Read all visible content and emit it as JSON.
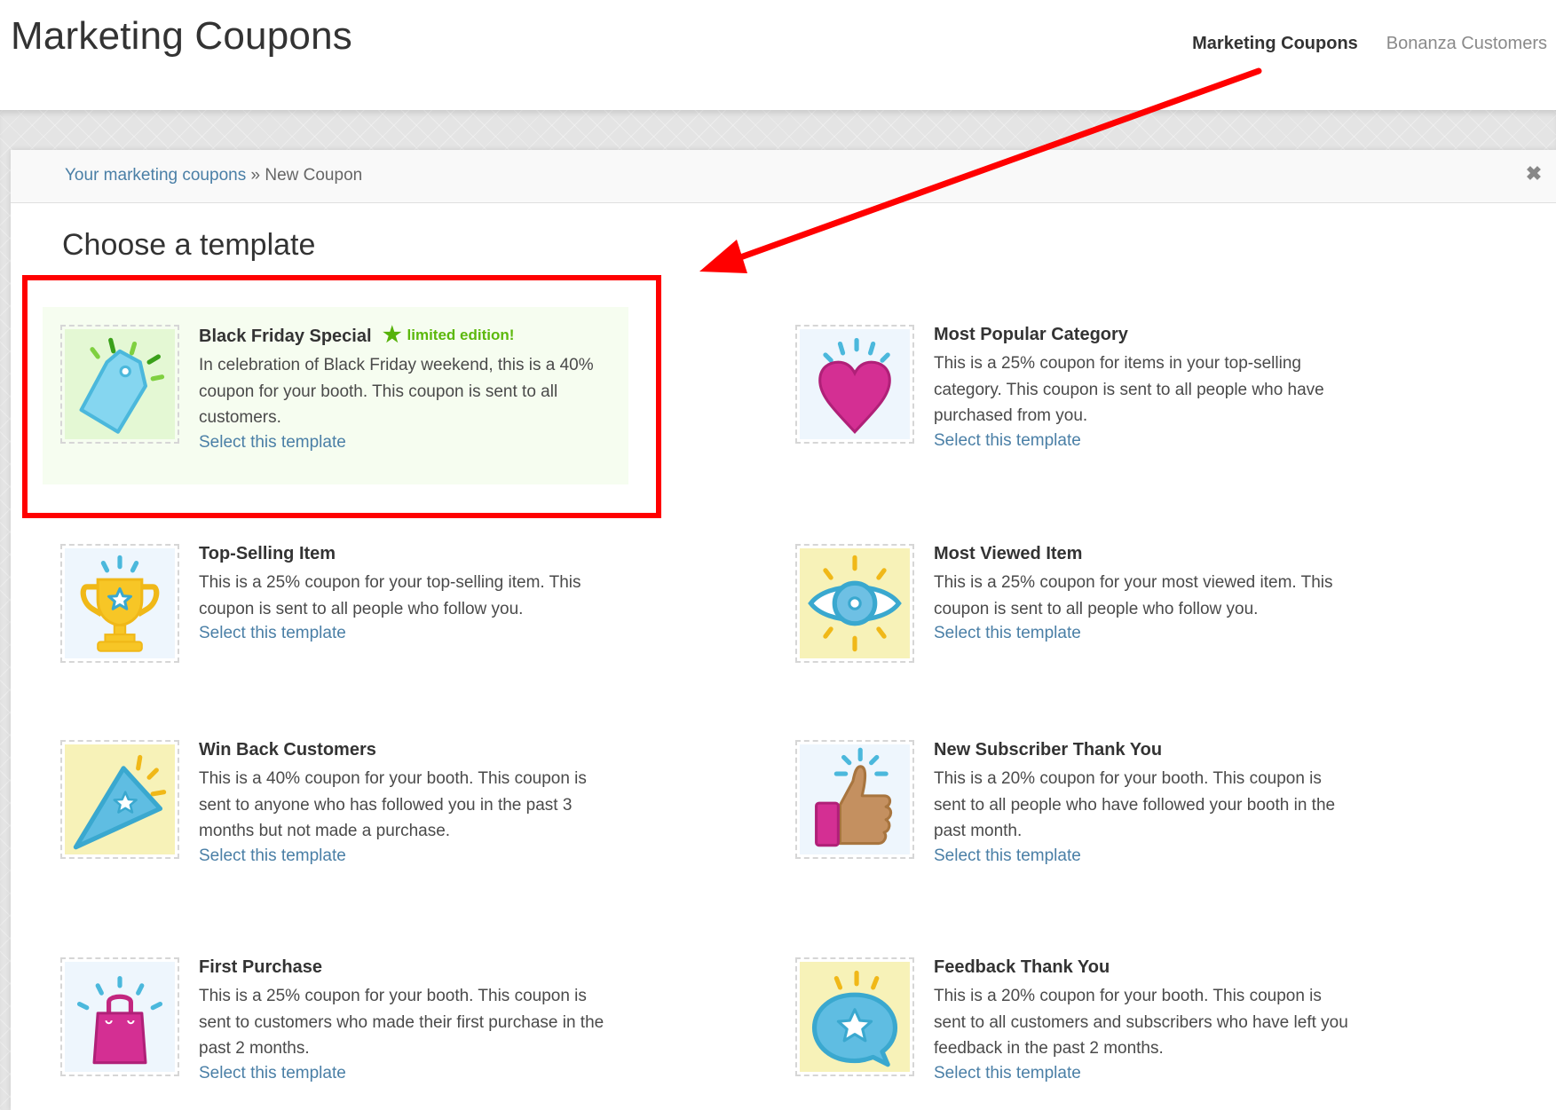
{
  "header": {
    "title": "Marketing Coupons",
    "nav": [
      {
        "label": "Marketing Coupons",
        "active": true
      },
      {
        "label": "Bonanza Customers",
        "active": false
      }
    ]
  },
  "panel": {
    "breadcrumb": {
      "link": "Your marketing coupons",
      "separator": "»",
      "current": "New Coupon"
    },
    "close_icon": "close-icon",
    "section_title": "Choose a template"
  },
  "templates": [
    {
      "title": "Black Friday Special",
      "badge": "limited edition!",
      "badge_icon": "star-icon",
      "description": "In celebration of Black Friday weekend, this is a 40% coupon for your booth. This coupon is sent to all customers.",
      "link": "Select this template",
      "icon": "price-tag-icon"
    },
    {
      "title": "Most Popular Category",
      "description": "This is a 25% coupon for items in your top-selling category. This coupon is sent to all people who have purchased from you.",
      "link": "Select this template",
      "icon": "heart-icon"
    },
    {
      "title": "Top-Selling Item",
      "description": "This is a 25% coupon for your top-selling item. This coupon is sent to all people who follow you.",
      "link": "Select this template",
      "icon": "trophy-icon"
    },
    {
      "title": "Most Viewed Item",
      "description": "This is a 25% coupon for your most viewed item. This coupon is sent to all people who follow you.",
      "link": "Select this template",
      "icon": "eye-icon"
    },
    {
      "title": "Win Back Customers",
      "description": "This is a 40% coupon for your booth. This coupon is sent to anyone who has followed you in the past 3 months but not made a purchase.",
      "link": "Select this template",
      "icon": "party-popper-icon"
    },
    {
      "title": "New Subscriber Thank You",
      "description": "This is a 20% coupon for your booth. This coupon is sent to all people who have followed your booth in the past month.",
      "link": "Select this template",
      "icon": "thumbs-up-icon"
    },
    {
      "title": "First Purchase",
      "description": "This is a 25% coupon for your booth. This coupon is sent to customers who made their first purchase in the past 2 months.",
      "link": "Select this template",
      "icon": "shopping-bag-icon"
    },
    {
      "title": "Feedback Thank You",
      "description": "This is a 20% coupon for your booth. This coupon is sent to all customers and subscribers who have left you feedback in the past 2 months.",
      "link": "Select this template",
      "icon": "speech-bubble-star-icon"
    }
  ],
  "colors": {
    "link": "#4a7fa6",
    "badge_green": "#5cb80c",
    "featured_bg": "#f6fdf0",
    "annotation_red": "#ff0000"
  }
}
